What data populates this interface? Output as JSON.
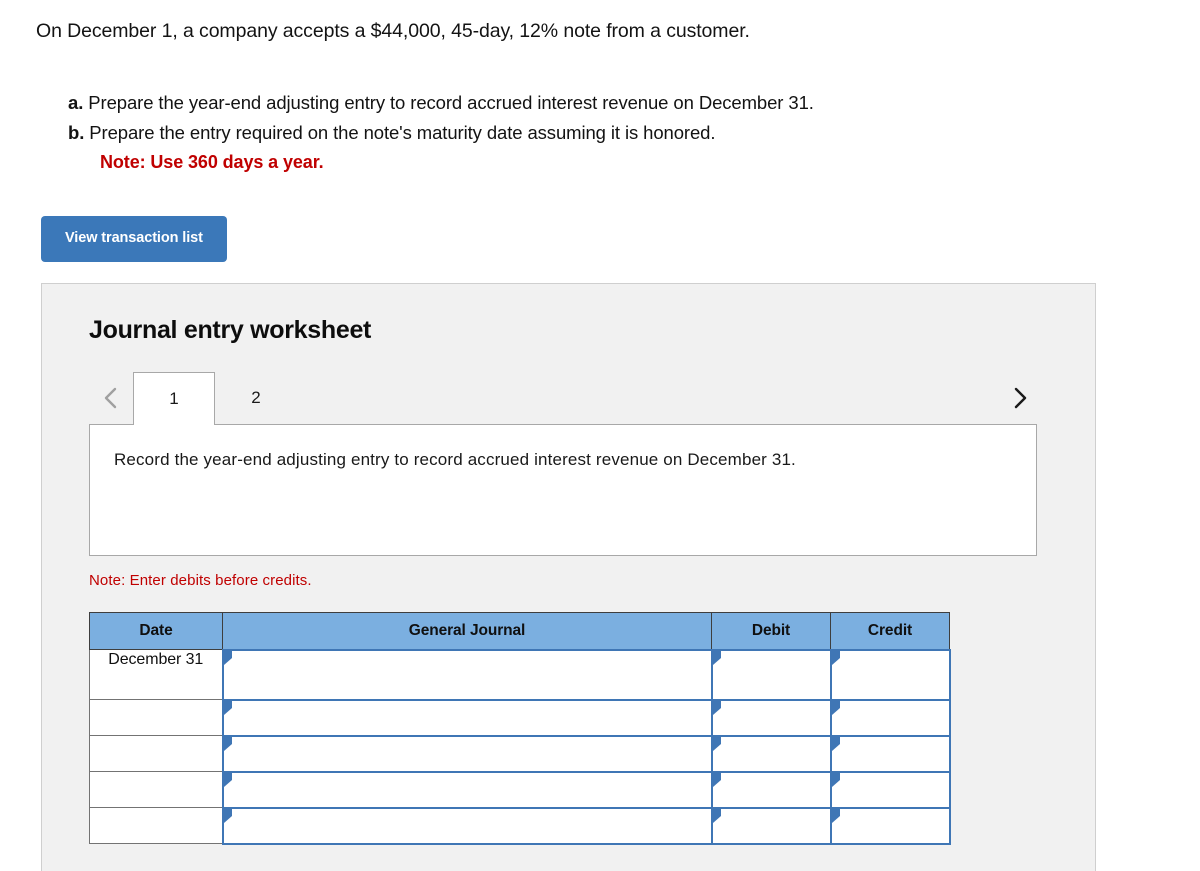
{
  "problem": {
    "lead": "On December 1, a company accepts a $44,000, 45-day, 12% note from a customer.",
    "requirements": [
      {
        "letter": "a.",
        "text": "Prepare the year-end adjusting entry to record accrued interest revenue on December 31."
      },
      {
        "letter": "b.",
        "text": "Prepare the entry required on the note's maturity date assuming it is honored."
      }
    ],
    "note": "Note: Use 360 days a year."
  },
  "toolbar": {
    "view_transaction_list_label": "View transaction list"
  },
  "worksheet": {
    "title": "Journal entry worksheet",
    "tabs": [
      {
        "label": "1",
        "active": true
      },
      {
        "label": "2",
        "active": false
      }
    ],
    "nav": {
      "prev_icon": "chevron-left-icon",
      "next_icon": "chevron-right-icon"
    },
    "instruction": "Record the year-end adjusting entry to record accrued interest revenue on December 31.",
    "credits_note": "Note: Enter debits before credits."
  },
  "journal_table": {
    "headers": [
      "Date",
      "General Journal",
      "Debit",
      "Credit"
    ],
    "rows": [
      {
        "date": "December 31",
        "general_journal": "",
        "debit": "",
        "credit": ""
      },
      {
        "date": "",
        "general_journal": "",
        "debit": "",
        "credit": ""
      },
      {
        "date": "",
        "general_journal": "",
        "debit": "",
        "credit": ""
      },
      {
        "date": "",
        "general_journal": "",
        "debit": "",
        "credit": ""
      },
      {
        "date": "",
        "general_journal": "",
        "debit": "",
        "credit": ""
      }
    ]
  },
  "colors": {
    "button_blue": "#3b78b9",
    "header_blue": "#7bafe0",
    "cell_border_blue": "#3f76b5",
    "note_red": "#c00000",
    "panel_gray": "#f1f1f1"
  }
}
